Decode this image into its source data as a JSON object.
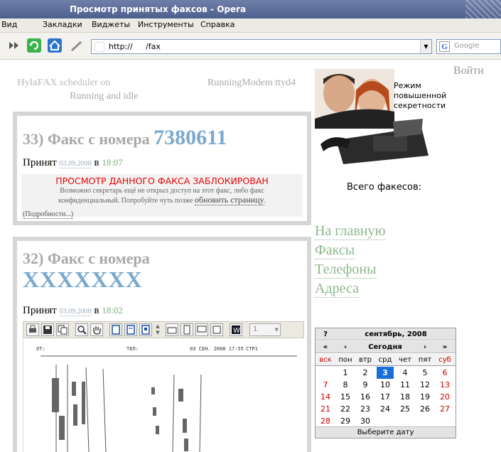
{
  "window": {
    "title": "Просмотр принятых факсов - Opera"
  },
  "menu": [
    "Вид",
    "Закладки",
    "Виджеты",
    "Инструменты",
    "Справка"
  ],
  "address": {
    "protocol": "http://",
    "path": "/fax"
  },
  "search": {
    "placeholder": "Google"
  },
  "status": {
    "scheduler_prefix": "HylaFAX",
    "scheduler_label": "scheduler on",
    "running": "Running and idle",
    "modem": "RunningModem ttyd4"
  },
  "faxes": [
    {
      "heading": "33) Факс с номера",
      "number": "7380611",
      "received_label": "Принят",
      "date": "03.09.2008",
      "in": "в",
      "time": "18:07",
      "blocked_title": "ПРОСМОТР ДАННОГО ФАКСА ЗАБЛОКИРОВАН",
      "blocked_text": "Возможно секретарь ещё не открыл доступ на этот факс, либо факс конфиденциальный. Попробуйте чуть позже",
      "refresh_link": "обновить страницу",
      "details": "(Подробности...)"
    },
    {
      "heading": "32) Факс с номера",
      "number": "XXXXXXX",
      "received_label": "Принят",
      "date": "03.09.2008",
      "in": "в",
      "time": "18:02",
      "viewer_page_value": "1",
      "page_header": {
        "from": "ОТ:",
        "tel": "ТЕЛ:",
        "datetime": "03 СЕН. 2008 17:55",
        "page": "СТР1"
      }
    }
  ],
  "sidebar": {
    "login": "Войти",
    "promo_text": [
      "Режим",
      "повышенной",
      "секретности"
    ],
    "total_label": "Всего факесов:",
    "nav": [
      "На главную",
      "Факсы",
      "Телефоны",
      "Адреса"
    ]
  },
  "calendar": {
    "help": "?",
    "month": "сентябрь, 2008",
    "prev_year": "«",
    "prev_month": "‹",
    "today": "Сегодня",
    "next_month": "›",
    "next_year": "»",
    "weekdays": [
      "вск",
      "пон",
      "втр",
      "срд",
      "чет",
      "пят",
      "суб"
    ],
    "weeks": [
      [
        "",
        "1",
        "2",
        "3",
        "4",
        "5",
        "6"
      ],
      [
        "7",
        "8",
        "9",
        "10",
        "11",
        "12",
        "13"
      ],
      [
        "14",
        "15",
        "16",
        "17",
        "18",
        "19",
        "20"
      ],
      [
        "21",
        "22",
        "23",
        "24",
        "25",
        "26",
        "27"
      ],
      [
        "28",
        "29",
        "30",
        "",
        "",
        "",
        ""
      ]
    ],
    "selected_day": "3",
    "footer": "Выберите дату"
  },
  "colors": {
    "accent_blue": "#7aa9cf",
    "nav_green": "#8fb88f",
    "blocked_red": "#e00000"
  }
}
